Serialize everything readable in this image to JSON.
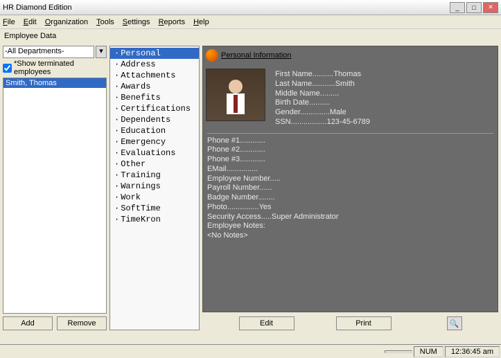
{
  "window": {
    "title": "HR Diamond Edition"
  },
  "menu": [
    "File",
    "Edit",
    "Organization",
    "Tools",
    "Settings",
    "Reports",
    "Help"
  ],
  "panel_label": "Employee Data",
  "left": {
    "dept": "-All Departments-",
    "show_term": "*Show terminated employees",
    "employees": [
      "Smith, Thomas"
    ],
    "add": "Add",
    "remove": "Remove"
  },
  "categories": [
    "Personal",
    "Address",
    "Attachments",
    "Awards",
    "Benefits",
    "Certifications",
    "Dependents",
    "Education",
    "Emergency",
    "Evaluations",
    "Other",
    "Training",
    "Warnings",
    "Work",
    "SoftTime",
    "TimeKron"
  ],
  "detail": {
    "title": "Personal Information",
    "head": "First Name..........Thomas\nLast Name...........Smith\nMiddle Name.........\nBirth Date..........\nGender..............Male\nSSN.................123-45-6789",
    "body": "Phone #1............\nPhone #2............\nPhone #3............\nEMail...............\nEmployee Number.....\nPayroll Number......\nBadge Number........\nPhoto...............Yes\nSecurity Access.....Super Administrator\nEmployee Notes:\n<No Notes>"
  },
  "buttons": {
    "edit": "Edit",
    "print": "Print"
  },
  "status": {
    "num": "NUM",
    "time": "12:36:45 am"
  }
}
